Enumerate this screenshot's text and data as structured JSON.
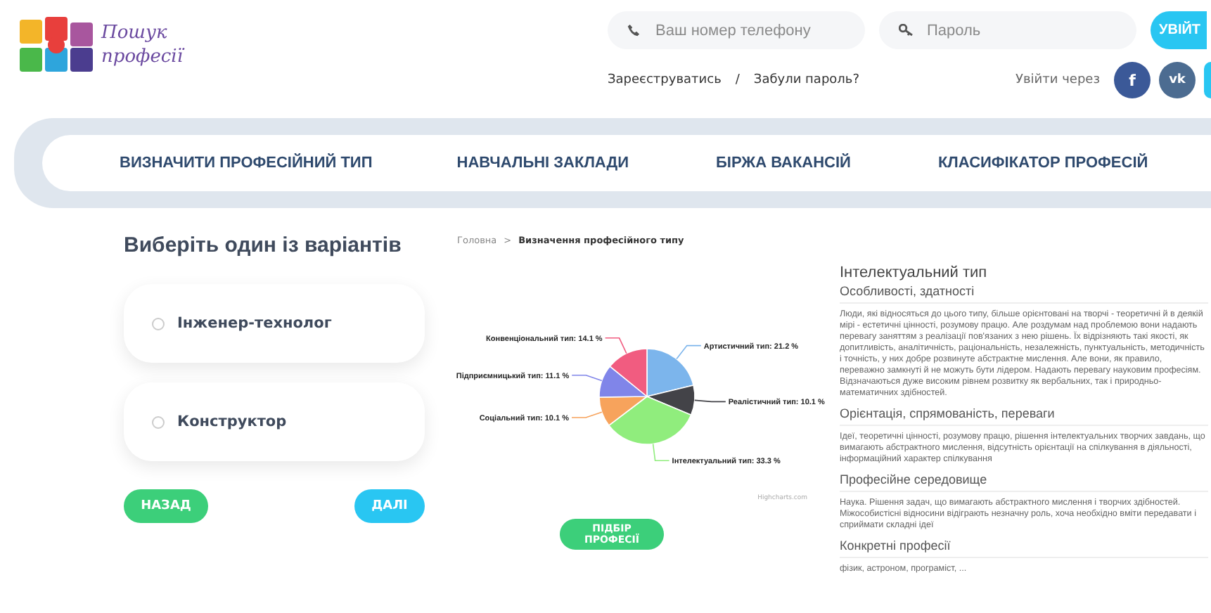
{
  "header": {
    "logo_line1": "Пошук",
    "logo_line2": "професії",
    "phone_placeholder": "Ваш номер телефону",
    "password_placeholder": "Пароль",
    "login_button": "УВІЙТ",
    "register_link": "Зареєструватись",
    "separator": "/",
    "forgot_link": "Забули пароль?",
    "social_label": "Увійти через",
    "social": [
      {
        "kind": "facebook",
        "glyph": "f"
      },
      {
        "kind": "vk",
        "glyph": "vk"
      },
      {
        "kind": "other"
      }
    ]
  },
  "nav": {
    "items": [
      {
        "label": "ВИЗНАЧИТИ ПРОФЕСІЙНИЙ ТИП"
      },
      {
        "label": "НАВЧАЛЬНІ ЗАКЛАДИ"
      },
      {
        "label": "БІРЖА ВАКАНСІЙ"
      },
      {
        "label": "КЛАСИФІКАТОР ПРОФЕСІЙ"
      }
    ]
  },
  "quiz": {
    "title": "Виберіть один із варіантів",
    "options": [
      {
        "label": "Інженер-технолог",
        "selected": false
      },
      {
        "label": "Конструктор",
        "selected": false
      }
    ],
    "back_button": "НАЗАД",
    "next_button": "ДАЛІ"
  },
  "breadcrumb": {
    "items": [
      {
        "label": "Головна",
        "current": false
      },
      {
        "label": "Визначення професійного типу",
        "current": true
      }
    ],
    "separator": ">"
  },
  "chart": {
    "chart_data": {
      "type": "pie",
      "values": [
        21.2,
        10.1,
        33.3,
        10.1,
        11.1,
        14.1
      ],
      "colors": [
        "#7cb5ec",
        "#434348",
        "#90ed7d",
        "#f7a35c",
        "#8085e9",
        "#f15c80"
      ],
      "value_labels": [
        "Артистичний тип: 21.2 %",
        "Реалістичний тип: 10.1 %",
        "Інтелектуальний тип: 33.3 %",
        "Соціальний тип: 10.1 %",
        "Підприємницький тип: 11.1 %",
        "Конвенціональний тип: 14.1 %"
      ]
    },
    "credit": "Highcharts.com",
    "button": "ПІДБІР ПРОФЕСІЇ"
  },
  "info": {
    "title": "Інтелектуальний тип",
    "sections": [
      {
        "heading": "Особливості, здатності",
        "text": "Люди, які відносяться до цього типу, більше орієнтовані на творчі - теоретичні й в деякій мірі - естетичні цінності, розумову працю. Але роздумам над проблемою вони надають перевагу заняттям з реалізації пов'язаних з нею рішень. Їх відрізняють такі якості, як допитливість, аналітичність, раціональність, незалежність, пунктуальність, методичність і точність, у них добре розвинуте абстрактне мислення. Але вони, як правило, переважно замкнуті й не можуть бути лідером. Надають перевагу науковим професіям. Відзначаються дуже високим рівнем розвитку як вербальних, так і природньо-математичних здібностей."
      },
      {
        "heading": "Орієнтація, спрямованість, переваги",
        "text": "Ідеї, теоретичні цінності, розумову працю, рішення інтелектуальних творчих завдань, що вимагають абстрактного мислення, відсутність орієнтації на спілкування в діяльності, інформаційний характер спілкування"
      },
      {
        "heading": "Професійне середовище",
        "text": "Наука. Рішення задач, що вимагають абстрактного мислення і творчих здібностей. Міжособистісні відносини відіграють незначну роль, хоча необхідно вміти передавати і сприймати складні ідеї"
      },
      {
        "heading": "Конкретні професії",
        "text": "фізик, астроном, програміст, ..."
      }
    ]
  }
}
